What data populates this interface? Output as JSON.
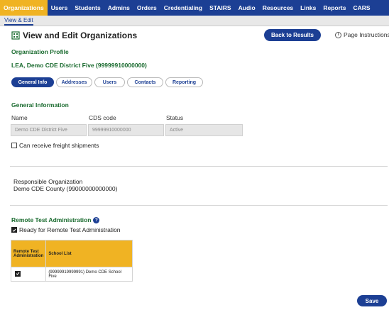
{
  "nav": {
    "items": [
      "Organizations",
      "Users",
      "Students",
      "Admins",
      "Orders",
      "Credentialing",
      "STAIRS",
      "Audio",
      "Resources",
      "Links",
      "Reports",
      "CARS"
    ],
    "active_index": 0
  },
  "subnav": {
    "tab": "View & Edit"
  },
  "page": {
    "title": "View and Edit Organizations",
    "back_label": "Back to Results",
    "instructions_label": "Page Instructions"
  },
  "profile": {
    "section_label": "Organization Profile",
    "org_name": "LEA, Demo CDE District Five (99999910000000)"
  },
  "tabs": [
    "General Info",
    "Addresses",
    "Users",
    "Contacts",
    "Reporting"
  ],
  "general": {
    "heading": "General Information",
    "name_label": "Name",
    "name_value": "Demo CDE District Five",
    "cds_label": "CDS code",
    "cds_value": "99999910000000",
    "status_label": "Status",
    "status_value": "Active",
    "freight_label": "Can receive freight shipments",
    "freight_checked": false
  },
  "responsible": {
    "label": "Responsible Organization",
    "value": "Demo CDE County (99000000000000)"
  },
  "remote": {
    "heading": "Remote Test Administration",
    "ready_label": "Ready for Remote Test Administration",
    "ready_checked": true,
    "table": {
      "col1": "Remote Test Administration",
      "col2": "School List",
      "rows": [
        {
          "checked": true,
          "school": "(99999919999991) Demo CDE School Five"
        }
      ]
    }
  },
  "actions": {
    "save_label": "Save"
  },
  "colors": {
    "brand": "#1c3f94",
    "accent": "#f0b323",
    "section": "#1a6b2f"
  }
}
